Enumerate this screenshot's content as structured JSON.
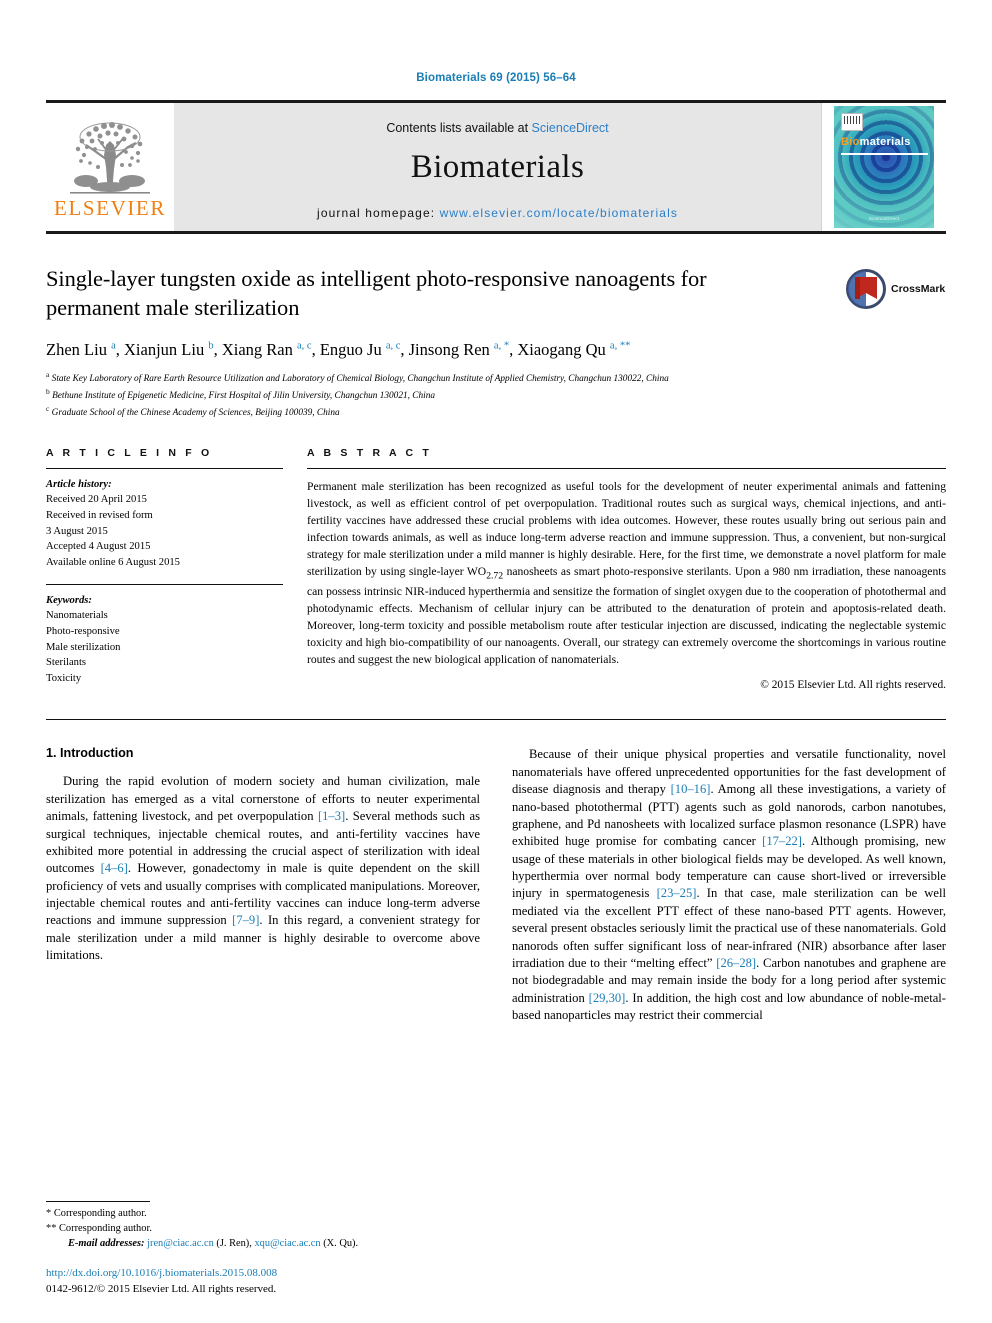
{
  "running_head": "Biomaterials 69 (2015) 56–64",
  "masthead": {
    "publisher_logo_text": "ELSEVIER",
    "contents_prefix": "Contents lists available at ",
    "contents_link": "ScienceDirect",
    "journal_name": "Biomaterials",
    "homepage_prefix": "journal homepage: ",
    "homepage_url": "www.elsevier.com/locate/biomaterials",
    "cover": {
      "title_bio": "Bio",
      "title_rest": "materials",
      "footer": "ScienceDirect"
    }
  },
  "article": {
    "title": "Single-layer tungsten oxide as intelligent photo-responsive nanoagents for permanent male sterilization",
    "crossmark_label": "CrossMark",
    "authors_html": "Zhen Liu <sup>a</sup>, Xianjun Liu <sup>b</sup>, Xiang Ran <sup>a, c</sup>, Enguo Ju <sup>a, c</sup>, Jinsong Ren <sup>a, *</sup>, Xiaogang Qu <sup>a, **</sup>",
    "affiliations": [
      "State Key Laboratory of Rare Earth Resource Utilization and Laboratory of Chemical Biology, Changchun Institute of Applied Chemistry, Changchun 130022, China",
      "Bethune Institute of Epigenetic Medicine, First Hospital of Jilin University, Changchun 130021, China",
      "Graduate School of the Chinese Academy of Sciences, Beijing 100039, China"
    ],
    "affiliation_marks": [
      "a",
      "b",
      "c"
    ]
  },
  "article_info": {
    "heading": "A R T I C L E   I N F O",
    "history_label": "Article history:",
    "history": [
      "Received 20 April 2015",
      "Received in revised form",
      "3 August 2015",
      "Accepted 4 August 2015",
      "Available online 6 August 2015"
    ],
    "keywords_label": "Keywords:",
    "keywords": [
      "Nanomaterials",
      "Photo-responsive",
      "Male sterilization",
      "Sterilants",
      "Toxicity"
    ]
  },
  "abstract": {
    "heading": "A B S T R A C T",
    "text_part1": "Permanent male sterilization has been recognized as useful tools for the development of neuter experimental animals and fattening livestock, as well as efficient control of pet overpopulation. Traditional routes such as surgical ways, chemical injections, and anti-fertility vaccines have addressed these crucial problems with idea outcomes. However, these routes usually bring out serious pain and infection towards animals, as well as induce long-term adverse reaction and immune suppression. Thus, a convenient, but non-surgical strategy for male sterilization under a mild manner is highly desirable. Here, for the first time, we demonstrate a novel platform for male sterilization by using single-layer WO",
    "formula_sub": "2.72",
    "text_part2": " nanosheets as smart photo-responsive sterilants. Upon a 980 nm irradiation, these nanoagents can possess intrinsic NIR-induced hyperthermia and sensitize the formation of singlet oxygen due to the cooperation of photothermal and photodynamic effects. Mechanism of cellular injury can be attributed to the denaturation of protein and apoptosis-related death. Moreover, long-term toxicity and possible metabolism route after testicular injection are discussed, indicating the neglectable systemic toxicity and high bio-compatibility of our nanoagents. Overall, our strategy can extremely overcome the shortcomings in various routine routes and suggest the new biological application of nanomaterials.",
    "copyright": "© 2015 Elsevier Ltd. All rights reserved."
  },
  "introduction": {
    "heading": "1. Introduction",
    "left_p1_a": "During the rapid evolution of modern society and human civilization, male sterilization has emerged as a vital cornerstone of efforts to neuter experimental animals, fattening livestock, and pet overpopulation ",
    "ref_1_3": "[1–3]",
    "left_p1_b": ". Several methods such as surgical techniques, injectable chemical routes, and anti-fertility vaccines have exhibited more potential in addressing the crucial aspect of sterilization with ideal outcomes ",
    "ref_4_6": "[4–6]",
    "left_p1_c": ". However, gonadectomy in male is quite dependent on the skill proficiency of vets and usually comprises with complicated manipulations. Moreover, injectable chemical routes and anti-fertility vaccines can induce long-term adverse reactions and immune suppression ",
    "ref_7_9": "[7–9]",
    "left_p1_d": ". In this regard, a convenient strategy for male sterilization under a mild manner is highly desirable to overcome above limitations.",
    "right_p1_a": "Because of their unique physical properties and versatile functionality, novel nanomaterials have offered unprecedented opportunities for the fast development of disease diagnosis and therapy ",
    "ref_10_16": "[10–16]",
    "right_p1_b": ". Among all these investigations, a variety of nano-based photothermal (PTT) agents such as gold nanorods, carbon nanotubes, graphene, and Pd nanosheets with localized surface plasmon resonance (LSPR) have exhibited huge promise for combating cancer ",
    "ref_17_22": "[17–22]",
    "right_p1_c": ". Although promising, new usage of these materials in other biological fields may be developed. As well known, hyperthermia over normal body temperature can cause short-lived or irreversible injury in spermatogenesis ",
    "ref_23_25": "[23–25]",
    "right_p1_d": ". In that case, male sterilization can be well mediated via the excellent PTT effect of these nano-based PTT agents. However, several present obstacles seriously limit the practical use of these nanomaterials. Gold nanorods often suffer significant loss of near-infrared (NIR) absorbance after laser irradiation due to their “melting effect” ",
    "ref_26_28": "[26–28]",
    "right_p1_e": ". Carbon nanotubes and graphene are not biodegradable and may remain inside the body for a long period after systemic administration ",
    "ref_29_30": "[29,30]",
    "right_p1_f": ". In addition, the high cost and low abundance of noble-metal-based nanoparticles may restrict their commercial"
  },
  "footnotes": {
    "corresponding_1_mark": "*",
    "corresponding_1": "Corresponding author.",
    "corresponding_2_mark": "**",
    "corresponding_2": "Corresponding author.",
    "email_label": "E-mail addresses:",
    "email_1": "jren@ciac.ac.cn",
    "email_1_owner": "(J. Ren),",
    "email_2": "xqu@ciac.ac.cn",
    "email_2_owner": "(X. Qu).",
    "doi": "http://dx.doi.org/10.1016/j.biomaterials.2015.08.008",
    "issn_line": "0142-9612/© 2015 Elsevier Ltd. All rights reserved."
  },
  "colors": {
    "link_blue": "#1a7db6",
    "elsevier_orange": "#f07f13"
  }
}
